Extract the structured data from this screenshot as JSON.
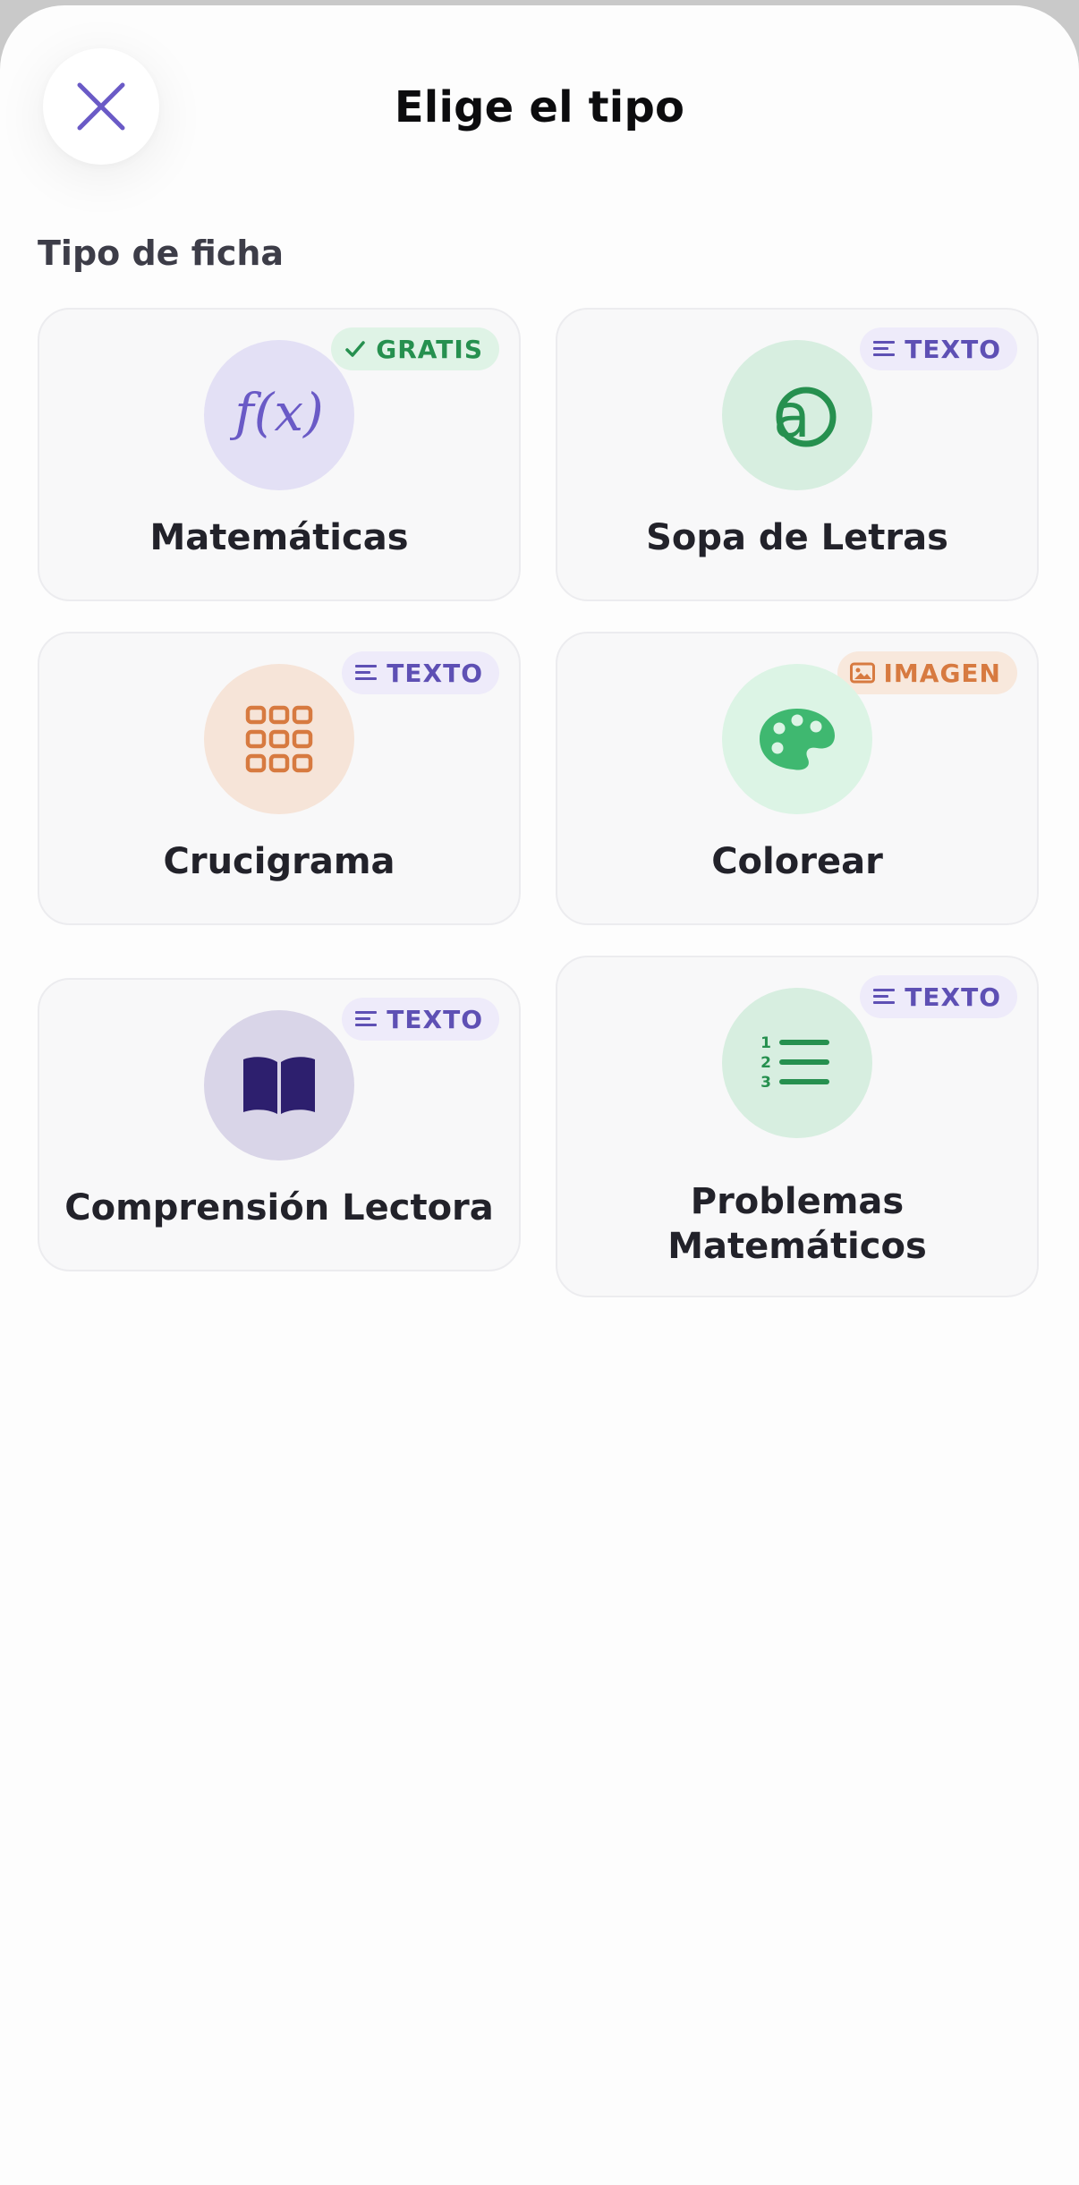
{
  "header": {
    "title": "Elige el tipo"
  },
  "section": {
    "label": "Tipo de ficha"
  },
  "cards": [
    {
      "label": "Matemáticas",
      "badge": "GRATIS",
      "icon": "function-icon"
    },
    {
      "label": "Sopa de Letras",
      "badge": "TEXTO",
      "icon": "letter-a-icon"
    },
    {
      "label": "Crucigrama",
      "badge": "TEXTO",
      "icon": "grid-icon"
    },
    {
      "label": "Colorear",
      "badge": "IMAGEN",
      "icon": "palette-icon"
    },
    {
      "label": "Comprensión Lectora",
      "badge": "TEXTO",
      "icon": "book-icon"
    },
    {
      "label_line1": "Problemas",
      "label_line2": "Matemáticos",
      "badge": "TEXTO",
      "icon": "numbered-list-icon"
    }
  ],
  "colors": {
    "accent_purple": "#6a5ac6",
    "green": "#26904f",
    "orange": "#d77a40"
  }
}
